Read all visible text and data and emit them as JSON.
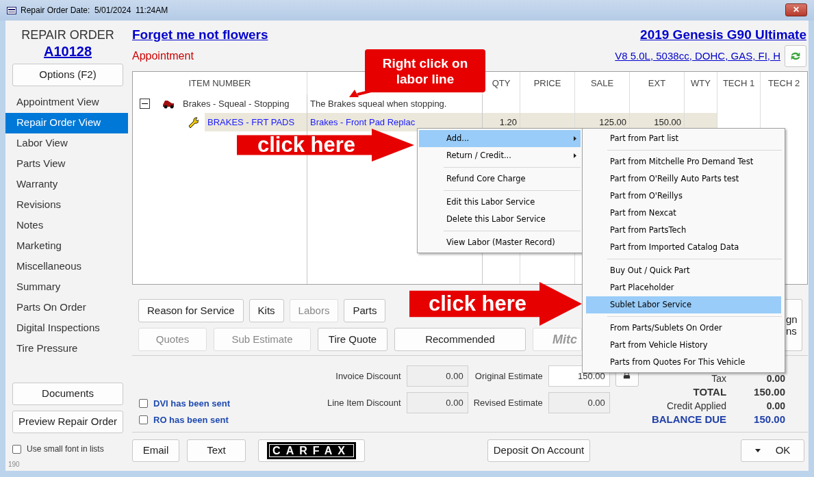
{
  "window": {
    "title": "Repair Order Date:  5/01/2024  11:24AM",
    "close": "✕"
  },
  "sidebar": {
    "heading": "REPAIR ORDER",
    "ro_number": "A10128",
    "options_button": "Options (F2)",
    "items": [
      {
        "label": "Appointment View",
        "selected": false
      },
      {
        "label": "Repair Order View",
        "selected": true
      },
      {
        "label": "Labor View",
        "selected": false
      },
      {
        "label": "Parts View",
        "selected": false
      },
      {
        "label": "Warranty",
        "selected": false
      },
      {
        "label": "Revisions",
        "selected": false
      },
      {
        "label": "Notes",
        "selected": false
      },
      {
        "label": "Marketing",
        "selected": false
      },
      {
        "label": "Miscellaneous",
        "selected": false
      },
      {
        "label": "Summary",
        "selected": false
      },
      {
        "label": "Parts On Order",
        "selected": false
      },
      {
        "label": "Digital Inspections",
        "selected": false
      },
      {
        "label": "Tire Pressure",
        "selected": false
      }
    ],
    "buttons": [
      "Documents",
      "Preview Repair Order"
    ],
    "small_font": {
      "label": "Use small font in lists",
      "checked": false
    },
    "version": "190"
  },
  "header": {
    "customer": "Forget me not flowers",
    "status": "Appointment",
    "vehicle": "2019 Genesis  G90 Ultimate",
    "engine": "V8 5.0L, 5038cc, DOHC, GAS, FI, H"
  },
  "table": {
    "columns": [
      "ITEM NUMBER",
      "",
      "QTY",
      "PRICE",
      "SALE",
      "EXT",
      "WTY",
      "TECH 1",
      "TECH 2"
    ],
    "rows": [
      {
        "kind": "concern",
        "expanded": true,
        "item": "Brakes - Squeal - Stopping",
        "description": "The Brakes squeal when stopping."
      },
      {
        "kind": "labor",
        "item": "BRAKES - FRT PADS",
        "description": "Brakes - Front Pad Replac",
        "qty": "1.20",
        "sale": "125.00",
        "ext": "150.00"
      }
    ]
  },
  "toolbar": {
    "row_1": [
      {
        "label": "Reason for Service",
        "disabled": false
      },
      {
        "label": "Kits",
        "disabled": false
      },
      {
        "label": "Labors",
        "disabled": true
      },
      {
        "label": "Parts",
        "disabled": false
      }
    ],
    "row_2": [
      {
        "label": "Quotes",
        "disabled": true
      },
      {
        "label": "Sub Estimate",
        "disabled": true
      },
      {
        "label": "Tire Quote",
        "disabled": false
      },
      {
        "label": "Recommended",
        "disabled": false
      }
    ],
    "logo_button": "Mitc",
    "side_button": [
      "gn",
      "ns"
    ]
  },
  "totals": {
    "invoice_discount": {
      "label": "Invoice Discount",
      "value": "0.00"
    },
    "line_item_discount": {
      "label": "Line Item Discount",
      "value": "0.00"
    },
    "original_estimate": {
      "label": "Original Estimate",
      "value": "150.00"
    },
    "revised_estimate": {
      "label": "Revised Estimate",
      "value": "0.00"
    },
    "checks": [
      {
        "label": "DVI has been sent",
        "checked": false
      },
      {
        "label": "RO has been sent",
        "checked": false
      }
    ],
    "lines": [
      {
        "kind": "normal",
        "label": "Tax",
        "value": "0.00"
      },
      {
        "kind": "total",
        "label": "TOTAL",
        "value": "150.00"
      },
      {
        "kind": "normal",
        "label": "Credit Applied",
        "value": "0.00"
      },
      {
        "kind": "balance",
        "label": "BALANCE DUE",
        "value": "150.00"
      }
    ]
  },
  "bottom_bar": {
    "email": "Email",
    "text": "Text",
    "carfax": "CARFAX",
    "deposit": "Deposit On Account",
    "ok": "OK"
  },
  "context_menu": [
    {
      "kind": "item",
      "label": "Add...",
      "submenu": true,
      "highlighted": true
    },
    {
      "kind": "item",
      "label": "Return / Credit...",
      "submenu": true,
      "highlighted": false
    },
    {
      "kind": "separator"
    },
    {
      "kind": "item",
      "label": "Refund Core Charge",
      "submenu": false,
      "highlighted": false
    },
    {
      "kind": "separator"
    },
    {
      "kind": "item",
      "label": "Edit this Labor Service",
      "submenu": false,
      "highlighted": false
    },
    {
      "kind": "item",
      "label": "Delete this Labor Service",
      "submenu": false,
      "highlighted": false
    },
    {
      "kind": "separator"
    },
    {
      "kind": "item",
      "label": "View Labor (Master Record)",
      "submenu": false,
      "highlighted": false
    }
  ],
  "submenu": [
    {
      "kind": "item",
      "label": "Part from Part list",
      "highlighted": false
    },
    {
      "kind": "separator"
    },
    {
      "kind": "item",
      "label": "Part from Mitchelle Pro Demand Test",
      "highlighted": false
    },
    {
      "kind": "item",
      "label": "Part from O'Reilly Auto Parts test",
      "highlighted": false
    },
    {
      "kind": "item",
      "label": "Part from O'Reillys",
      "highlighted": false
    },
    {
      "kind": "item",
      "label": "Part from Nexcat",
      "highlighted": false
    },
    {
      "kind": "item",
      "label": "Part from PartsTech",
      "highlighted": false
    },
    {
      "kind": "item",
      "label": "Part from Imported Catalog Data",
      "highlighted": false
    },
    {
      "kind": "separator"
    },
    {
      "kind": "item",
      "label": "Buy Out / Quick Part",
      "highlighted": false
    },
    {
      "kind": "item",
      "label": "Part Placeholder",
      "highlighted": false
    },
    {
      "kind": "item",
      "label": "Sublet Labor Service",
      "highlighted": true
    },
    {
      "kind": "separator"
    },
    {
      "kind": "item",
      "label": "From Parts/Sublets On Order",
      "highlighted": false
    },
    {
      "kind": "item",
      "label": "Part from Vehicle History",
      "highlighted": false
    },
    {
      "kind": "item",
      "label": "Parts from Quotes For This Vehicle",
      "highlighted": false
    }
  ],
  "callouts": {
    "note": "Right click on labor line",
    "arrow_1": "click here",
    "arrow_2": "click here"
  }
}
